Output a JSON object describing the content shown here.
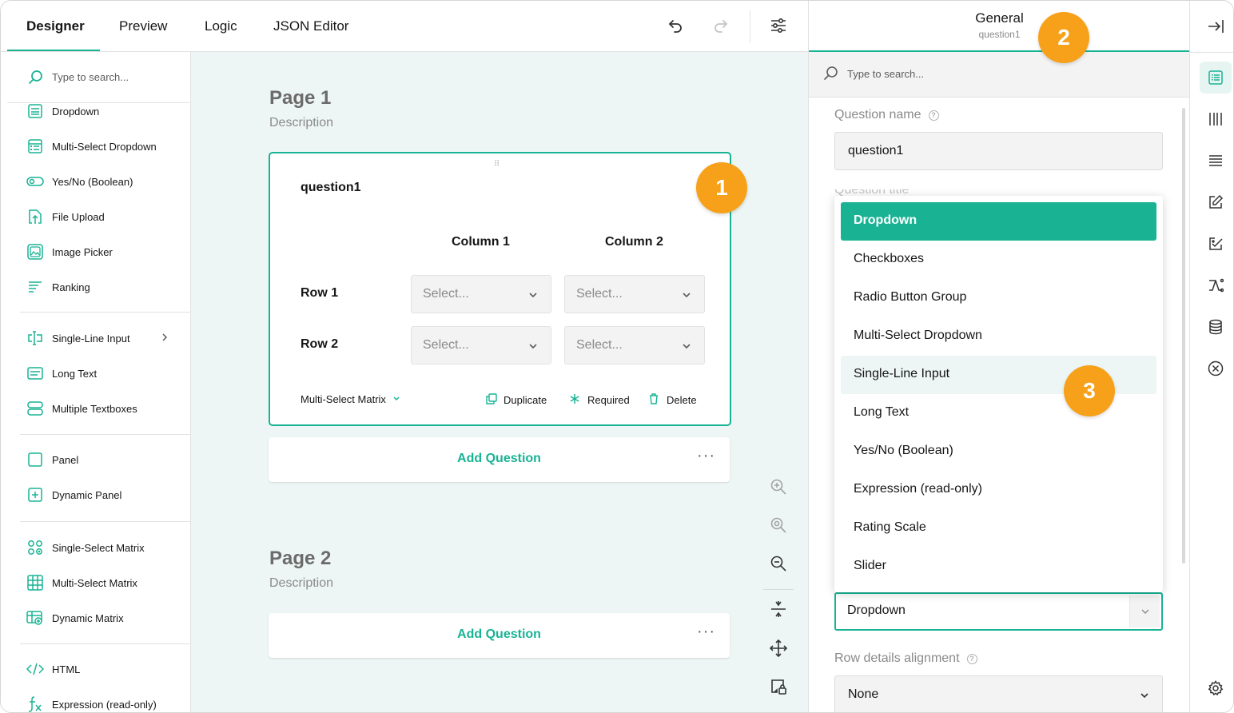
{
  "tabs": [
    {
      "label": "Designer"
    },
    {
      "label": "Preview"
    },
    {
      "label": "Logic"
    },
    {
      "label": "JSON Editor"
    }
  ],
  "toolbox": {
    "search_placeholder": "Type to search...",
    "items": [
      {
        "label": "Dropdown",
        "icon": "dropdown-icon"
      },
      {
        "label": "Multi-Select Dropdown",
        "icon": "multi-select-dropdown-icon"
      },
      {
        "label": "Yes/No (Boolean)",
        "icon": "toggle-icon"
      },
      {
        "label": "File Upload",
        "icon": "file-upload-icon"
      },
      {
        "label": "Image Picker",
        "icon": "image-picker-icon"
      },
      {
        "label": "Ranking",
        "icon": "ranking-icon"
      },
      {
        "label": "Single-Line Input",
        "icon": "text-cursor-icon"
      },
      {
        "label": "Long Text",
        "icon": "long-text-icon"
      },
      {
        "label": "Multiple Textboxes",
        "icon": "multiple-textboxes-icon"
      },
      {
        "label": "Panel",
        "icon": "panel-icon"
      },
      {
        "label": "Dynamic Panel",
        "icon": "dynamic-panel-icon"
      },
      {
        "label": "Single-Select Matrix",
        "icon": "single-select-matrix-icon"
      },
      {
        "label": "Multi-Select Matrix",
        "icon": "grid-icon"
      },
      {
        "label": "Dynamic Matrix",
        "icon": "dynamic-matrix-icon"
      },
      {
        "label": "HTML",
        "icon": "code-icon"
      },
      {
        "label": "Expression (read-only)",
        "icon": "function-icon"
      }
    ]
  },
  "canvas": {
    "page1": {
      "title": "Page 1",
      "description": "Description"
    },
    "page2": {
      "title": "Page 2",
      "description": "Description"
    },
    "question": {
      "title": "question1",
      "columns": [
        "Column 1",
        "Column 2"
      ],
      "rows": [
        "Row 1",
        "Row 2"
      ],
      "select_placeholder": "Select...",
      "type_label": "Multi-Select Matrix",
      "duplicate": "Duplicate",
      "required": "Required",
      "delete": "Delete"
    },
    "add_question": "Add Question",
    "more": "···"
  },
  "badges": [
    "1",
    "2",
    "3"
  ],
  "properties": {
    "header_title": "General",
    "header_subtitle": "question1",
    "search_placeholder": "Type to search...",
    "question_name_label": "Question name",
    "question_name_value": "question1",
    "question_title_label_peek": "Question title",
    "cell_type_value": "Dropdown",
    "row_details_label": "Row details alignment",
    "row_details_value": "None",
    "help_glyph": "?"
  },
  "dropdown_options": [
    {
      "label": "Dropdown",
      "state": "selected"
    },
    {
      "label": "Checkboxes",
      "state": "normal"
    },
    {
      "label": "Radio Button Group",
      "state": "normal"
    },
    {
      "label": "Multi-Select Dropdown",
      "state": "normal"
    },
    {
      "label": "Single-Line Input",
      "state": "hover"
    },
    {
      "label": "Long Text",
      "state": "normal"
    },
    {
      "label": "Yes/No (Boolean)",
      "state": "normal"
    },
    {
      "label": "Expression (read-only)",
      "state": "normal"
    },
    {
      "label": "Rating Scale",
      "state": "normal"
    },
    {
      "label": "Slider",
      "state": "normal"
    }
  ],
  "colors": {
    "accent": "#19b394",
    "badge": "#f7a11a",
    "canvas_bg": "#edf6f4"
  }
}
